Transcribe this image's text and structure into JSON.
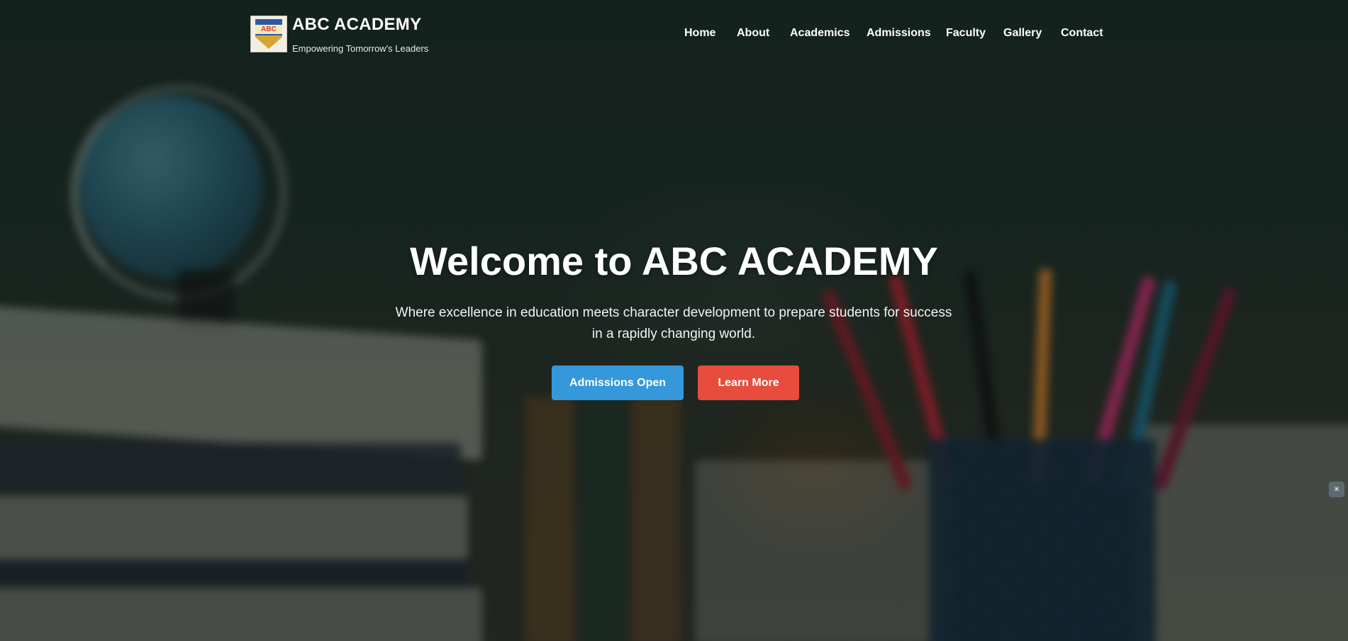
{
  "brand": {
    "title": "ABC ACADEMY",
    "tagline": "Empowering Tomorrow's Leaders",
    "logo_text": "ABC",
    "logo_icon": "school-crest-icon"
  },
  "nav": {
    "items": [
      {
        "label": "Home"
      },
      {
        "label": "About"
      },
      {
        "label": "Academics"
      },
      {
        "label": "Admissions"
      },
      {
        "label": "Faculty"
      },
      {
        "label": "Gallery"
      },
      {
        "label": "Contact"
      }
    ]
  },
  "hero": {
    "title": "Welcome to ABC ACADEMY",
    "subtitle": "Where excellence in education meets character development to prepare students for success in a rapidly changing world.",
    "primary_button": "Admissions Open",
    "secondary_button": "Learn More"
  },
  "side_widget": {
    "icon": "extension-icon",
    "glyph": "⌘"
  },
  "colors": {
    "primary": "#3498db",
    "secondary": "#e74c3c",
    "text": "#ffffff"
  }
}
